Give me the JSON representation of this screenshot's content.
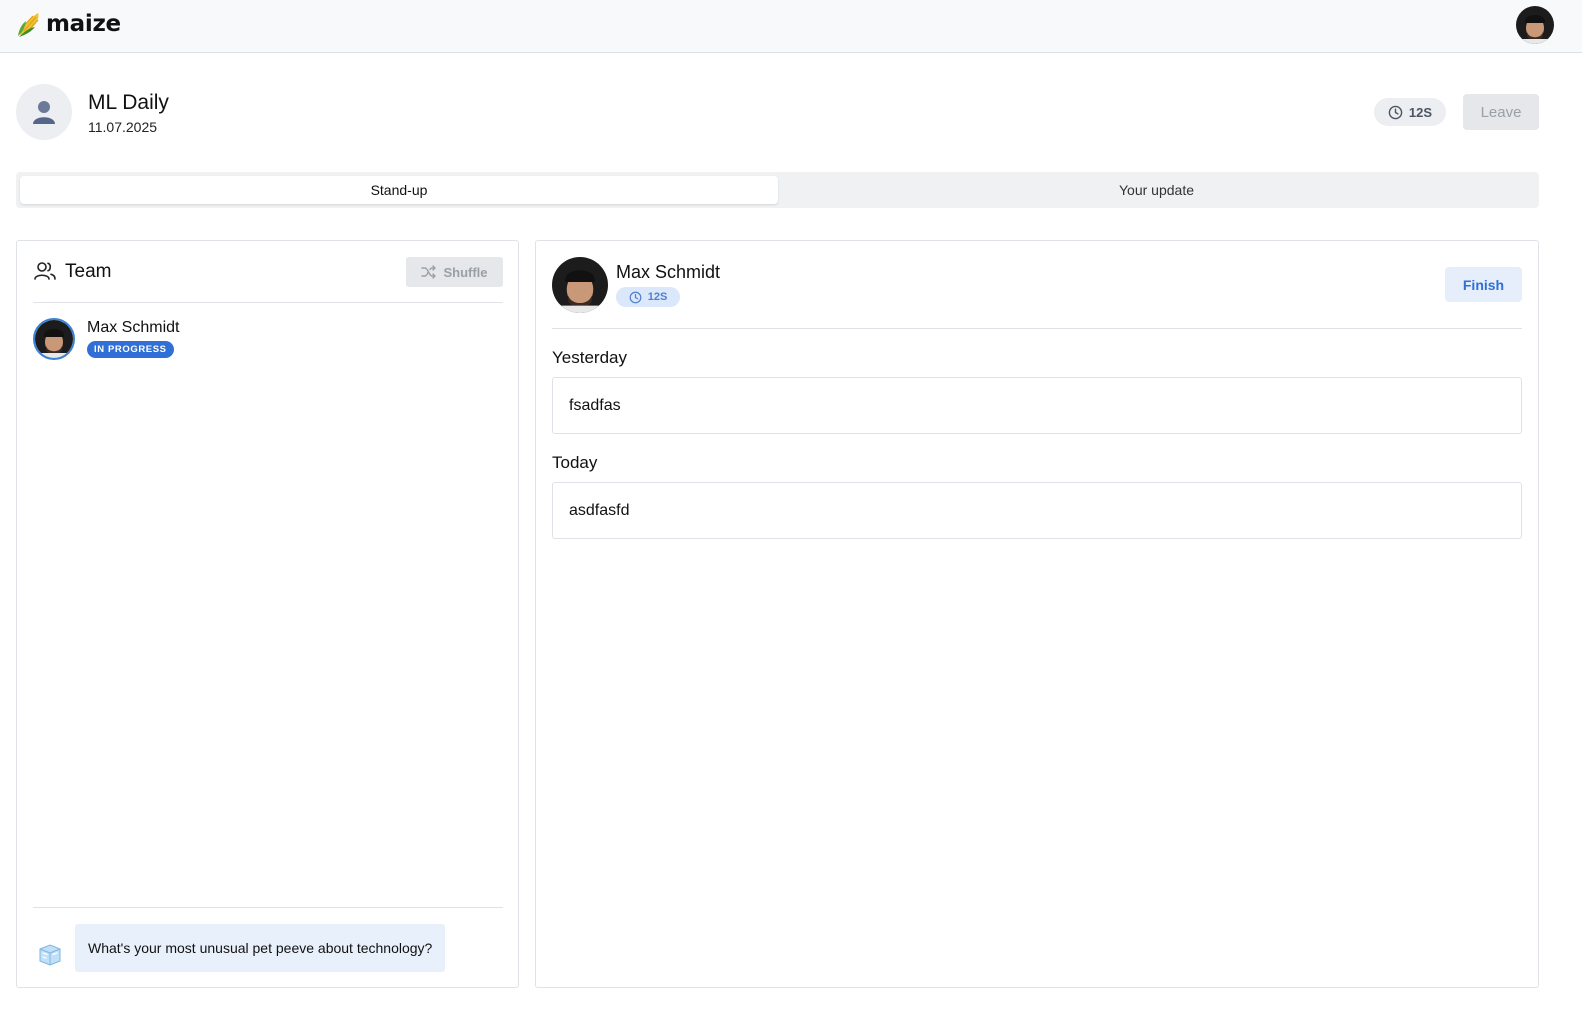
{
  "app": {
    "name": "maize",
    "logo_icon": "corn-icon"
  },
  "user": {
    "avatar_icon": "user-photo-avatar"
  },
  "meeting": {
    "title": "ML Daily",
    "date": "11.07.2025",
    "timer": "12S",
    "leave_label": "Leave",
    "avatar_icon": "person-icon"
  },
  "tabs": [
    {
      "label": "Stand-up",
      "active": true
    },
    {
      "label": "Your update",
      "active": false
    }
  ],
  "team": {
    "title": "Team",
    "shuffle_label": "Shuffle",
    "members": [
      {
        "name": "Max Schmidt",
        "status": "IN PROGRESS"
      }
    ],
    "icebreaker": "What's your most unusual pet peeve about technology?",
    "icebreaker_icon": "ice-cube-icon"
  },
  "speaker": {
    "name": "Max Schmidt",
    "timer": "12S",
    "finish_label": "Finish",
    "sections": [
      {
        "label": "Yesterday",
        "value": "fsadfas"
      },
      {
        "label": "Today",
        "value": "asdfasfd"
      }
    ]
  },
  "colors": {
    "accent": "#2f6fd6",
    "accent_light": "#e5eefa",
    "topbar_bg": "#f8f9fa",
    "icebreaker_bg": "#e8f1fb"
  }
}
